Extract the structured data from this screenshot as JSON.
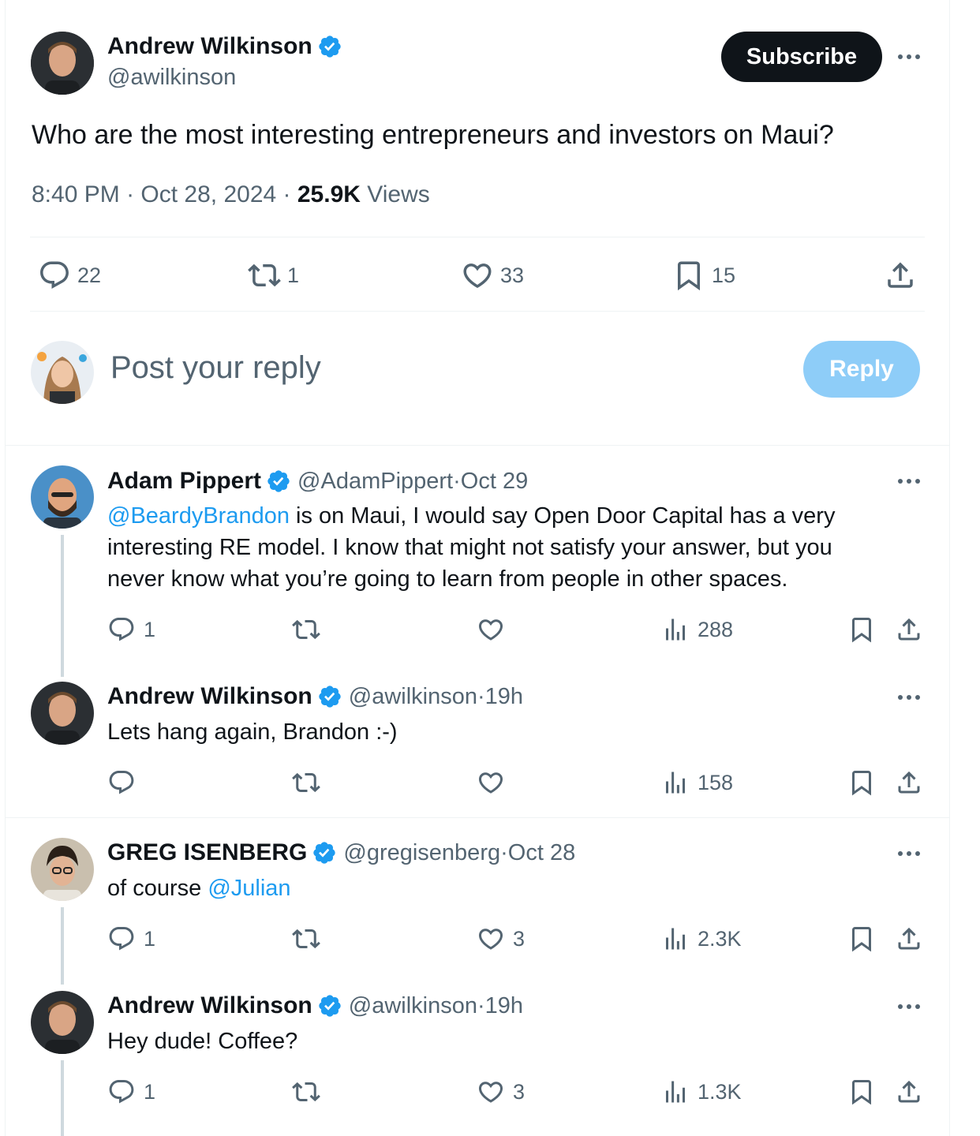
{
  "main": {
    "author_name": "Andrew Wilkinson",
    "author_handle": "@awilkinson",
    "subscribe_label": "Subscribe",
    "text": "Who are the most interesting entrepreneurs and investors on Maui?",
    "time": "8:40 PM",
    "date": "Oct 28, 2024",
    "views_count": "25.9K",
    "views_label": "Views",
    "replies": "22",
    "reposts": "1",
    "likes": "33",
    "bookmarks": "15"
  },
  "composer": {
    "placeholder": "Post your reply",
    "reply_label": "Reply"
  },
  "replies": [
    {
      "name": "Adam Pippert",
      "handle": "@AdamPippert",
      "time": "Oct 29",
      "mention": "@BeardyBrandon",
      "text_line1": " is on Maui, I would say Open Door Capital has a very",
      "text_line2": "interesting RE model.  I know that might not satisfy your answer, but you",
      "text_line3": "never know what you’re going to learn from people in other spaces.",
      "replies": "1",
      "reposts": "",
      "likes": "",
      "views": "288"
    },
    {
      "name": "Andrew Wilkinson",
      "handle": "@awilkinson",
      "time": "19h",
      "text": "Lets hang again, Brandon :-)",
      "replies": "",
      "reposts": "",
      "likes": "",
      "views": "158"
    },
    {
      "name": "GREG ISENBERG",
      "handle": "@gregisenberg",
      "time": "Oct 28",
      "text_prefix": "of course ",
      "mention": "@Julian",
      "replies": "1",
      "reposts": "",
      "likes": "3",
      "views": "2.3K"
    },
    {
      "name": "Andrew Wilkinson",
      "handle": "@awilkinson",
      "time": "19h",
      "text": "Hey dude! Coffee?",
      "replies": "1",
      "reposts": "",
      "likes": "3",
      "views": "1.3K"
    }
  ],
  "separator": " · ",
  "colors": {
    "accent": "#1d9bf0",
    "text_primary": "#0f1419",
    "text_secondary": "#536471",
    "reply_button_disabled": "#8ecdf8",
    "divider": "#eff3f4",
    "thread_line": "#cfd9de"
  },
  "icons": {
    "reply": "speech-bubble-icon",
    "repost": "repost-arrows-icon",
    "like": "heart-icon",
    "views": "bar-chart-icon",
    "bookmark": "bookmark-icon",
    "share": "share-upload-icon",
    "verified": "verified-badge-icon",
    "more": "more-dots-icon"
  }
}
